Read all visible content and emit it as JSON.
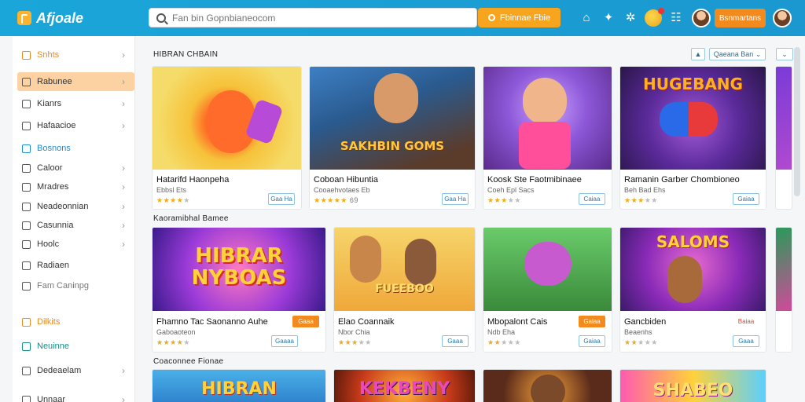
{
  "app": {
    "name": "Afjoale"
  },
  "search": {
    "placeholder": "Fan bin Gopnbianeocom",
    "button_label": "Fbinnae Fbie"
  },
  "header": {
    "account_button": "Bsnmartans"
  },
  "sidebar": {
    "items": [
      {
        "label": "Snhts",
        "icon": "grid-icon",
        "style": "orange",
        "chevron": true
      },
      {
        "label": "Rabunee",
        "icon": "clock-icon",
        "style": "active",
        "chevron": true
      },
      {
        "label": "Kianrs",
        "icon": "card-icon",
        "style": "",
        "chevron": true
      },
      {
        "label": "Hafaacioe",
        "icon": "flag-icon",
        "style": "",
        "chevron": true
      },
      {
        "label": "Bosnons",
        "icon": "star-icon",
        "style": "blue",
        "chevron": false
      },
      {
        "label": "Caloor",
        "icon": "user-icon",
        "style": "",
        "chevron": true
      },
      {
        "label": "Mradres",
        "icon": "tag-icon",
        "style": "",
        "chevron": true
      },
      {
        "label": "Neadeonnian",
        "icon": "puzzle-icon",
        "style": "",
        "chevron": true
      },
      {
        "label": "Casunnia",
        "icon": "globe-icon",
        "style": "",
        "chevron": true
      },
      {
        "label": "Hoolc",
        "icon": "bulb-icon",
        "style": "",
        "chevron": true
      },
      {
        "label": "Radiaen",
        "icon": "box-icon",
        "style": "",
        "chevron": false
      },
      {
        "label": "Fam Caninpg",
        "icon": "smile-icon",
        "style": "muted",
        "chevron": false
      },
      {
        "label": "Dilkits",
        "icon": "bag-icon",
        "style": "orange",
        "chevron": false
      },
      {
        "label": "Neuinne",
        "icon": "music-icon",
        "style": "teal",
        "chevron": false
      },
      {
        "label": "Dedeaelam",
        "icon": "settings-icon",
        "style": "",
        "chevron": true
      },
      {
        "label": "Unnaar",
        "icon": "mail-icon",
        "style": "",
        "chevron": true
      }
    ]
  },
  "sections": [
    {
      "title": "HIBRAN CHBAIN"
    },
    {
      "title": "Kaoramibhal Bamee"
    },
    {
      "title": "Coaconnee Fionae"
    }
  ],
  "toolbar": {
    "filter_label": "Qaeana Ban"
  },
  "cards_row1": [
    {
      "title": "Hatarifd Haonpeha",
      "sub": "Ebbsl Ets",
      "stars": "★★★★",
      "grey": "★",
      "rating": "",
      "btn": "Gaa Ha",
      "art_text": ""
    },
    {
      "title": "Coboan Hibuntia",
      "sub": "Cooaehvotaes Eb",
      "stars": "★★★★★",
      "grey": "",
      "rating": "69",
      "btn": "Gaa Ha",
      "art_text": "SAKHBIN GOMS"
    },
    {
      "title": "Koosk Ste Faotmibinaee",
      "sub": "Coeh Epl Sacs",
      "stars": "★★★",
      "grey": "★★",
      "rating": "",
      "btn": "Caiaa",
      "art_text": ""
    },
    {
      "title": "Ramanin Garber Chombioneo",
      "sub": "Beh Bad Ehs",
      "stars": "★★★",
      "grey": "★★",
      "rating": "",
      "btn": "Gaiaa",
      "art_text": "HUGEBANG"
    }
  ],
  "cards_row2": [
    {
      "title": "Fhamno Tac Saonanno Auhe",
      "sub": "Gaboaoteon",
      "stars": "★★★★",
      "grey": "★",
      "btn": "Gaaa",
      "btn_style": "filled",
      "btn2": "Gaaaa",
      "art_text": "HIBRAR NYBOAS"
    },
    {
      "title": "Elao Coannaik",
      "sub": "Nbor Chia",
      "stars": "★★★",
      "grey": "★★",
      "btn": "Gaaa",
      "btn_style": "",
      "btn2": "",
      "art_text": "FUEEBOO"
    },
    {
      "title": "Mbopalont Cais",
      "sub": "Ndb Eha",
      "stars": "★★",
      "grey": "★★★",
      "btn": "Gaiaa",
      "btn_style": "filled",
      "btn2": "Gaiaa",
      "art_text": ""
    },
    {
      "title": "Gancbiden",
      "sub": "Beaenhs",
      "stars": "★★",
      "grey": "★★★",
      "btn": "Baiaa",
      "btn_style": "text-red",
      "btn2": "Gaaa",
      "art_text": "SALOMS"
    }
  ],
  "cards_row3": [
    {
      "art_text": "HIBRAN"
    },
    {
      "art_text": "KEKBENY"
    },
    {
      "art_text": ""
    },
    {
      "art_text": "SHABEO"
    }
  ],
  "colors": {
    "topbar": "#1aa6d9",
    "accent": "#f28a1e",
    "active_bg": "#fcd2a2",
    "star": "#f2a81d",
    "link": "#1b8fd0"
  }
}
